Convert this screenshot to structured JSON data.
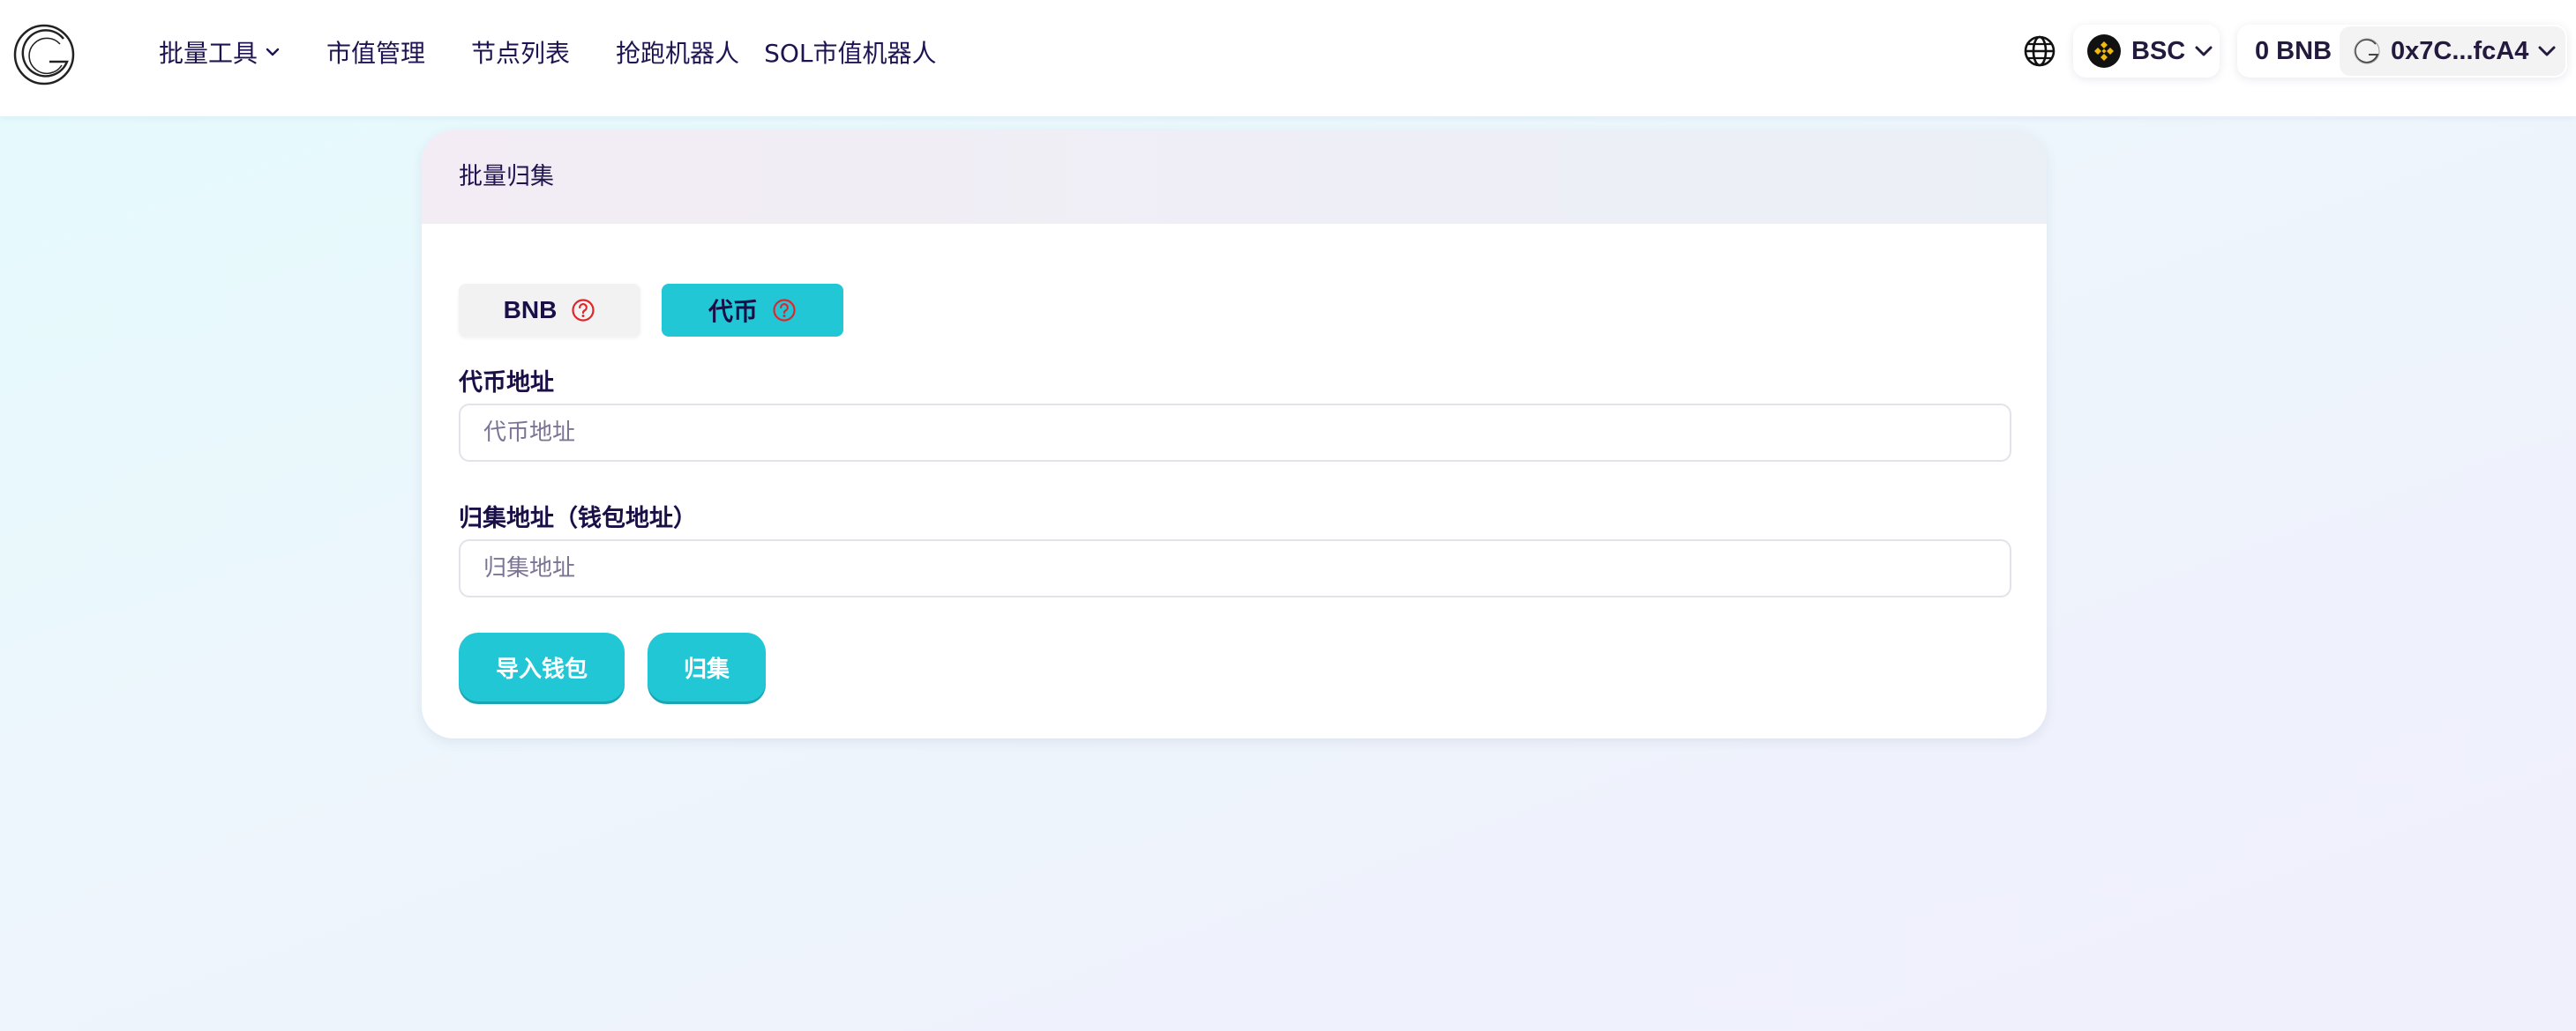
{
  "header": {
    "nav": [
      {
        "label": "批量工具",
        "has_dropdown": true
      },
      {
        "label": "市值管理"
      },
      {
        "label": "节点列表"
      },
      {
        "label": "抢跑机器人"
      },
      {
        "label": "SOL市值机器人"
      }
    ],
    "chain": {
      "label": "BSC",
      "icon": "bnb-chain-icon",
      "icon_color": "#f0b90b"
    },
    "account": {
      "balance": "0 BNB",
      "address": "0x7C...fcA4"
    }
  },
  "card": {
    "title": "批量归集",
    "tabs": [
      {
        "label": "BNB",
        "active": false
      },
      {
        "label": "代币",
        "active": true
      }
    ],
    "fields": [
      {
        "label": "代币地址",
        "placeholder": "代币地址",
        "value": ""
      },
      {
        "label": "归集地址（钱包地址）",
        "placeholder": "归集地址",
        "value": ""
      }
    ],
    "buttons": {
      "import_wallet": "导入钱包",
      "collect": "归集"
    }
  },
  "colors": {
    "accent": "#22c7d6",
    "help_icon": "#e0262b",
    "text": "#1a0f47"
  }
}
